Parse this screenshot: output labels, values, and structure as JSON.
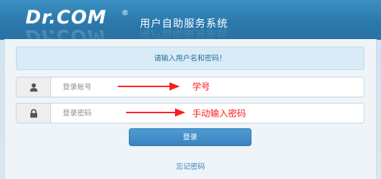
{
  "header": {
    "logo_text": "Dr.COM",
    "registered_mark": "®",
    "system_title": "用户自助服务系统"
  },
  "login": {
    "notice": "请输入用户名和密码！",
    "username_placeholder": "登录账号",
    "password_placeholder": "登录密码",
    "login_button": "登录",
    "forgot_link": "忘记密码"
  },
  "annotations": {
    "username_hint": "学号",
    "password_hint": "手动输入密码"
  },
  "colors": {
    "header_blue": "#2b79ad",
    "button_blue": "#3a85c1",
    "annotation_red": "#ff1a1a"
  },
  "icons": {
    "username_icon": "user-icon",
    "password_icon": "lock-icon"
  }
}
